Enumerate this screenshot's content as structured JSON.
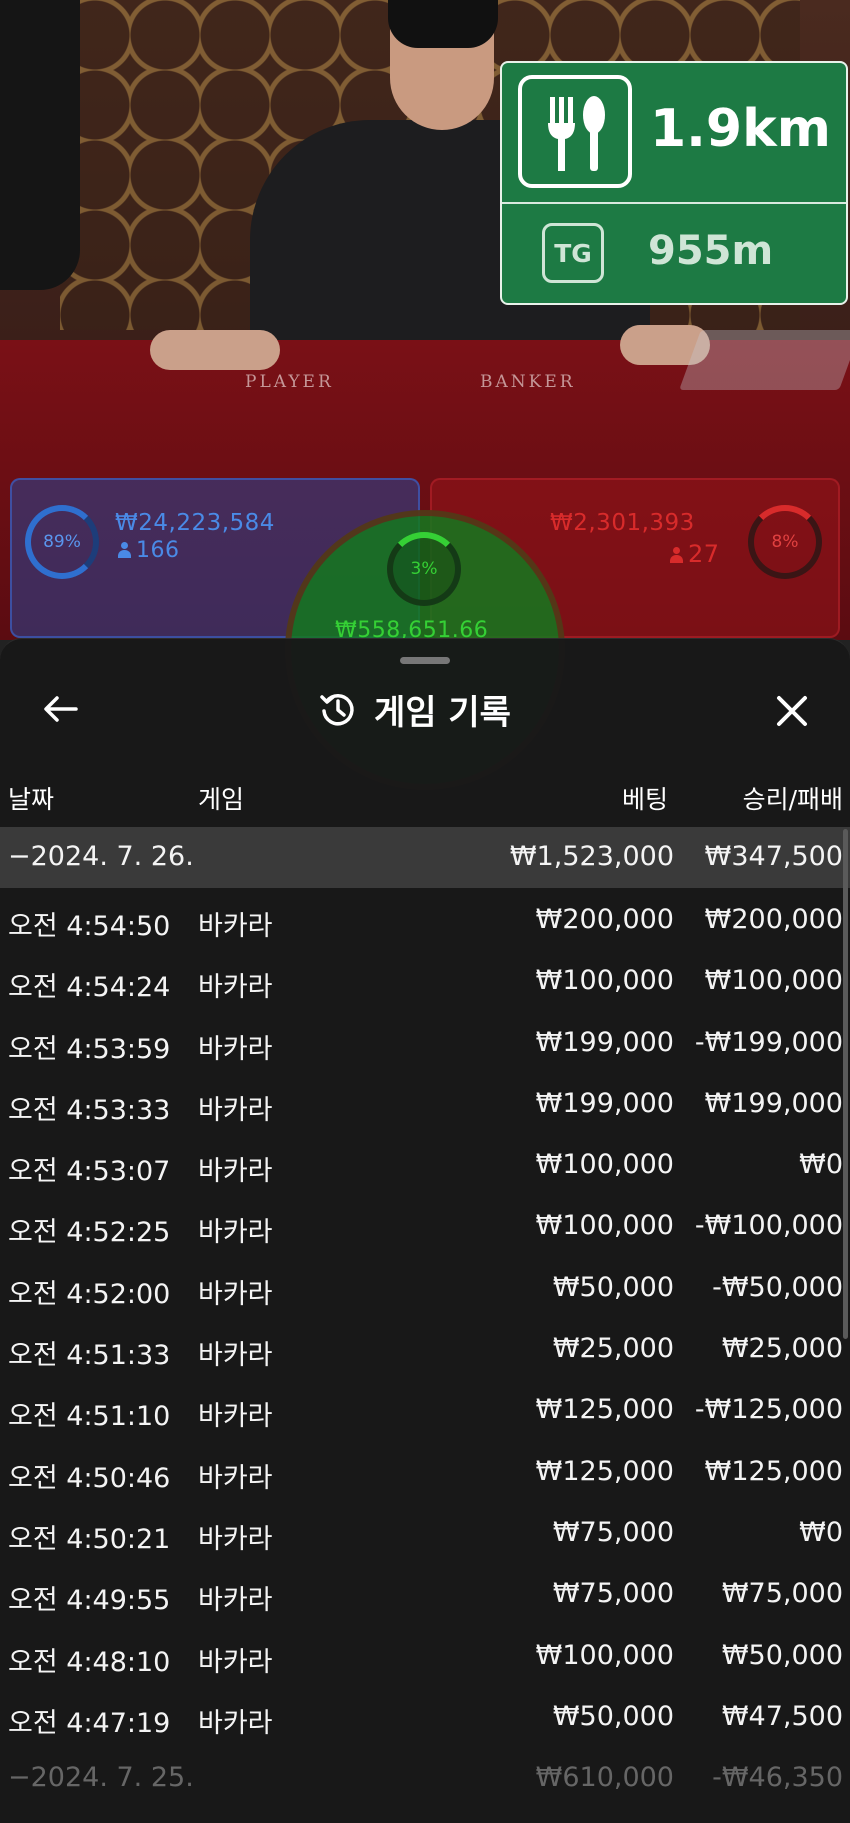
{
  "stream": {
    "felt_labels": {
      "player": "PLAYER",
      "banker": "BANKER"
    },
    "player": {
      "percent": "89%",
      "amount": "₩24,223,584",
      "count": "166"
    },
    "banker": {
      "percent": "8%",
      "amount": "₩2,301,393",
      "count": "27"
    },
    "tie": {
      "percent": "3%",
      "amount": "₩558,651.66"
    }
  },
  "sign": {
    "food_distance": "1.9km",
    "tg_label": "TG",
    "tg_distance": "955m"
  },
  "history": {
    "title": "게임 기록",
    "columns": {
      "date": "날짜",
      "game": "게임",
      "bet": "베팅",
      "win_loss": "승리/패배"
    },
    "groups": [
      {
        "date": "−2024. 7. 26.",
        "total_bet": "₩1,523,000",
        "total_result": "₩347,500",
        "rows": [
          {
            "time": "오전 4:54:50",
            "game": "바카라",
            "bet": "₩200,000",
            "result": "₩200,000"
          },
          {
            "time": "오전 4:54:24",
            "game": "바카라",
            "bet": "₩100,000",
            "result": "₩100,000"
          },
          {
            "time": "오전 4:53:59",
            "game": "바카라",
            "bet": "₩199,000",
            "result": "-₩199,000"
          },
          {
            "time": "오전 4:53:33",
            "game": "바카라",
            "bet": "₩199,000",
            "result": "₩199,000"
          },
          {
            "time": "오전 4:53:07",
            "game": "바카라",
            "bet": "₩100,000",
            "result": "₩0"
          },
          {
            "time": "오전 4:52:25",
            "game": "바카라",
            "bet": "₩100,000",
            "result": "-₩100,000"
          },
          {
            "time": "오전 4:52:00",
            "game": "바카라",
            "bet": "₩50,000",
            "result": "-₩50,000"
          },
          {
            "time": "오전 4:51:33",
            "game": "바카라",
            "bet": "₩25,000",
            "result": "₩25,000"
          },
          {
            "time": "오전 4:51:10",
            "game": "바카라",
            "bet": "₩125,000",
            "result": "-₩125,000"
          },
          {
            "time": "오전 4:50:46",
            "game": "바카라",
            "bet": "₩125,000",
            "result": "₩125,000"
          },
          {
            "time": "오전 4:50:21",
            "game": "바카라",
            "bet": "₩75,000",
            "result": "₩0"
          },
          {
            "time": "오전 4:49:55",
            "game": "바카라",
            "bet": "₩75,000",
            "result": "₩75,000"
          },
          {
            "time": "오전 4:48:10",
            "game": "바카라",
            "bet": "₩100,000",
            "result": "₩50,000"
          },
          {
            "time": "오전 4:47:19",
            "game": "바카라",
            "bet": "₩50,000",
            "result": "₩47,500"
          }
        ]
      },
      {
        "date": "−2024. 7. 25.",
        "total_bet": "₩610,000",
        "total_result": "-₩46,350"
      }
    ]
  }
}
